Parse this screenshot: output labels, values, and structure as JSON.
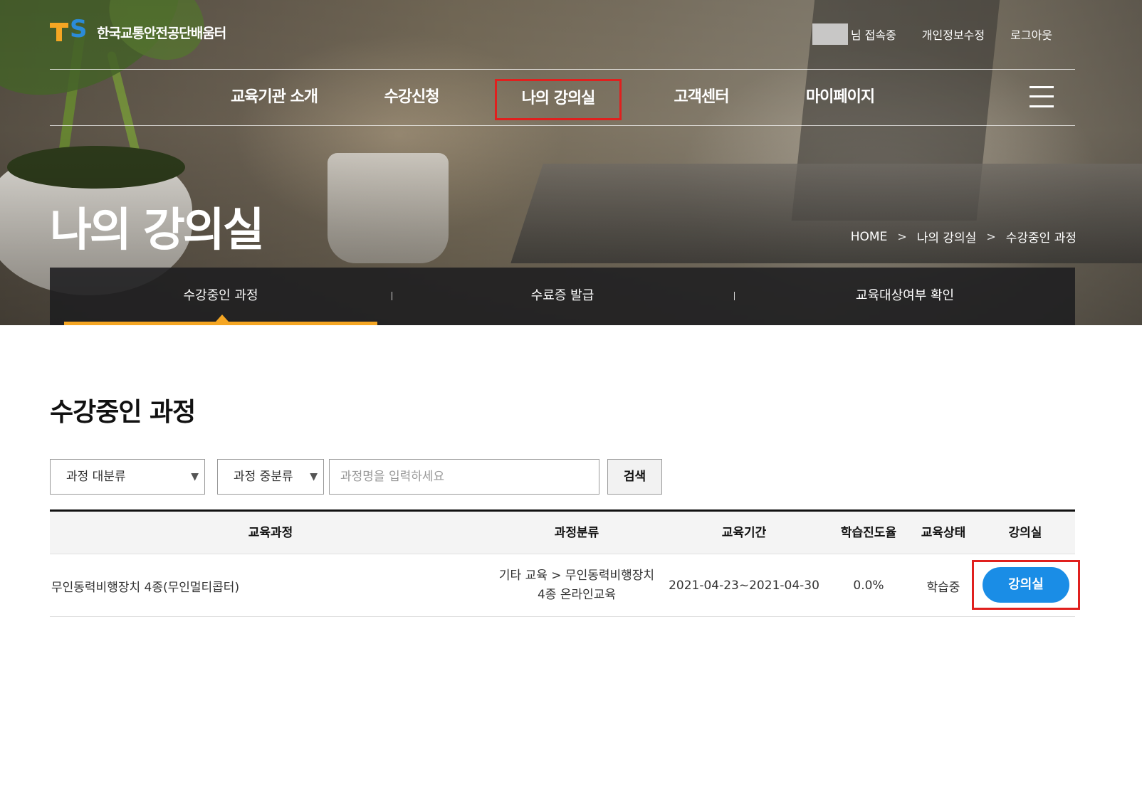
{
  "header": {
    "logo_mark": "TS",
    "logo_text": "한국교통안전공단배움터",
    "util": {
      "user_status": "님 접속중",
      "edit_profile": "개인정보수정",
      "logout": "로그아웃"
    },
    "nav": [
      {
        "label": "교육기관 소개"
      },
      {
        "label": "수강신청"
      },
      {
        "label": "나의 강의실",
        "active": true
      },
      {
        "label": "고객센터"
      },
      {
        "label": "마이페이지"
      }
    ]
  },
  "hero": {
    "title": "나의 강의실",
    "breadcrumb": [
      "HOME",
      "나의 강의실",
      "수강중인 과정"
    ],
    "breadcrumb_sep": ">"
  },
  "subnav": {
    "items": [
      {
        "label": "수강중인 과정",
        "active": true
      },
      {
        "label": "수료증 발급"
      },
      {
        "label": "교육대상여부 확인"
      }
    ]
  },
  "content": {
    "section_title": "수강중인 과정",
    "filter": {
      "major_select": "과정 대분류",
      "middle_select": "과정 중분류",
      "search_placeholder": "과정명을 입력하세요",
      "search_button": "검색"
    },
    "table": {
      "headers": [
        "교육과정",
        "과정분류",
        "교육기간",
        "학습진도율",
        "교육상태",
        "강의실"
      ],
      "rows": [
        {
          "course": "무인동력비행장치 4종(무인멀티콥터)",
          "category_line1": "기타 교육 > 무인동력비행장치",
          "category_line2": "4종 온라인교육",
          "period": "2021-04-23~2021-04-30",
          "progress": "0.0%",
          "status": "학습중",
          "action": "강의실"
        }
      ]
    }
  },
  "colors": {
    "accent_orange": "#f5a623",
    "logo_blue": "#2b8bd8",
    "button_blue": "#1a8de6",
    "highlight_red": "#e0201e"
  }
}
